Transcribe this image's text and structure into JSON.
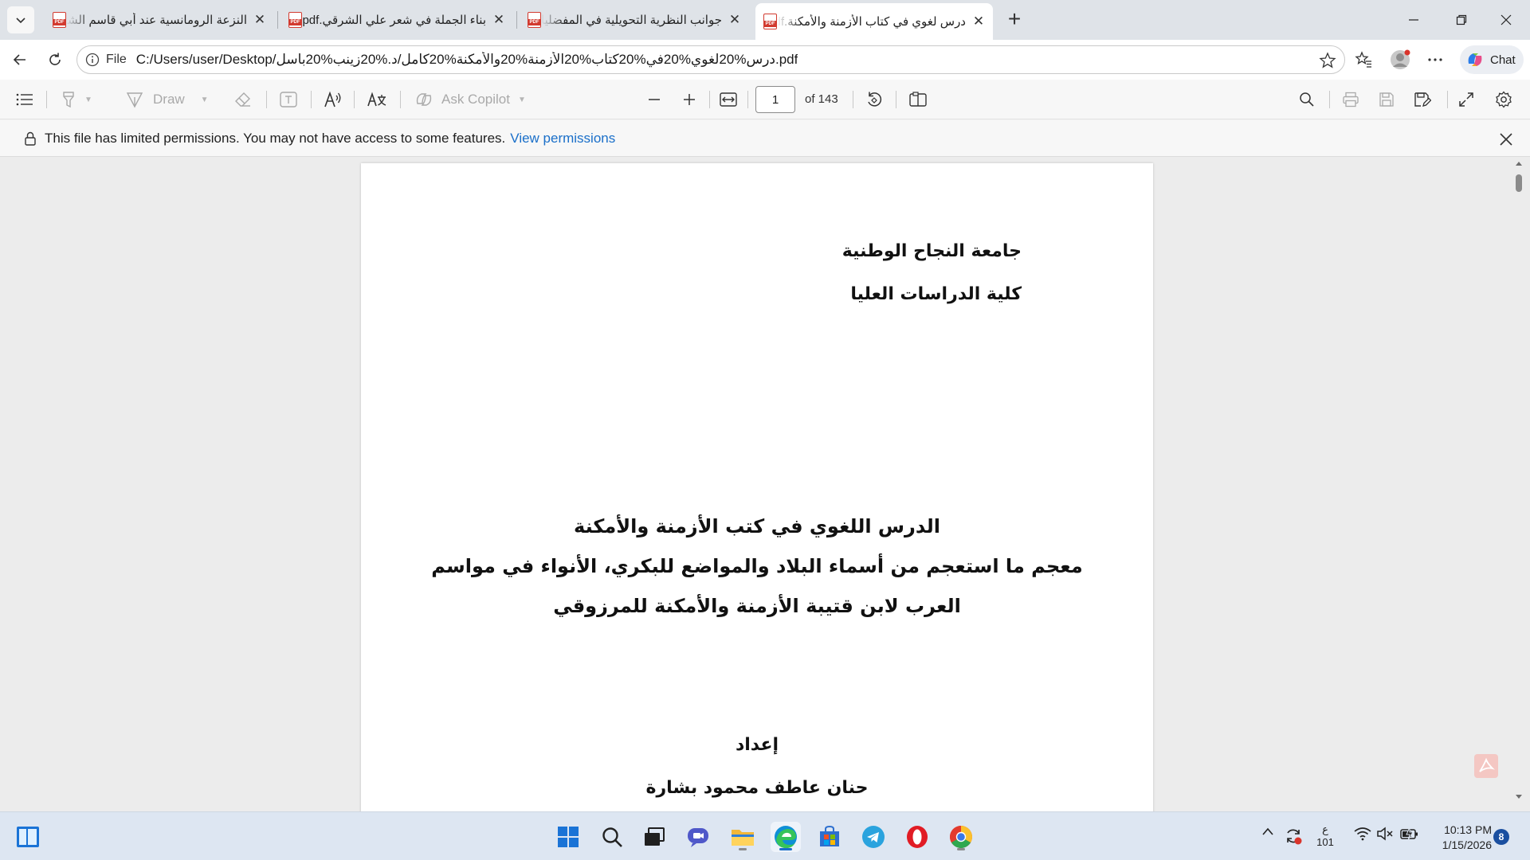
{
  "tabs": [
    {
      "title": "النزعة الرومانسية عند أبي قاسم الشابي",
      "active": false
    },
    {
      "title": "بناء الجملة في شعر علي الشرقي.pdf",
      "active": false
    },
    {
      "title": "جوانب النظرية التحويلية في المفضليات",
      "active": false
    },
    {
      "title": "درس لغوي في كتاب الأزمنة والأمكنة.pdf",
      "active": true
    }
  ],
  "address_bar": {
    "scheme_label": "File",
    "url": "C:/Users/user/Desktop/درس%20لغوي%20في%20كتاب%20الأزمنة%20والأمكنة%20كامل/د.%20زينب%20باسل.pdf",
    "chat_label": "Chat"
  },
  "pdf_toolbar": {
    "draw_label": "Draw",
    "ask_copilot_label": "Ask Copilot",
    "page_number": "1",
    "page_total": "of 143"
  },
  "infobar": {
    "message": "This file has limited permissions. You may not have access to some features.",
    "link": "View permissions"
  },
  "document": {
    "university": "جامعة النجاح الوطنية",
    "faculty": "كلية الدراسات العليا",
    "title_line1": "الدرس اللغوي في كتب الأزمنة والأمكنة",
    "title_line2": "معجم ما استعجم من أسماء البلاد والمواضع للبكري، الأنواء في مواسم",
    "title_line3": "العرب لابن قتيبة الأزمنة والأمكنة للمرزوقي",
    "prepared_by_label": "إعداد",
    "author": "حنان عاطف محمود بشارة"
  },
  "taskbar": {
    "language_line1": "ع",
    "language_line2": "101",
    "time": "10:13 PM",
    "date": "1/15/2026",
    "notification_count": "8"
  },
  "colors": {
    "accent": "#1a6fc9",
    "pdf_red": "#d23a2f"
  }
}
